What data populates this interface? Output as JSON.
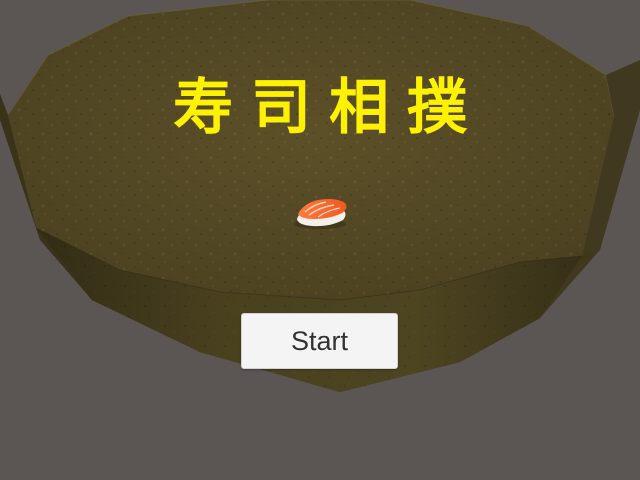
{
  "game": {
    "title": "寿司相撲",
    "start_label": "Start"
  },
  "scene": {
    "arena": "dohyo-ring",
    "player_piece": "salmon-nigiri-sushi"
  },
  "colors": {
    "background": "#5b5553",
    "title": "#fff200",
    "button_background": "#f4f4f4",
    "button_text": "#323232"
  }
}
